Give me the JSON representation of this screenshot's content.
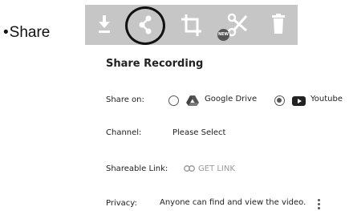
{
  "bullet": {
    "marker": "•",
    "label": "Share"
  },
  "toolbar": {
    "buttons": [
      {
        "name": "download-icon"
      },
      {
        "name": "share-icon",
        "highlighted": true
      },
      {
        "name": "crop-icon"
      },
      {
        "name": "scissors-icon",
        "badge": "NEW"
      },
      {
        "name": "trash-icon"
      }
    ],
    "background_color": "#c6c6c6",
    "icon_color": "#ffffff"
  },
  "panel": {
    "title": "Share Recording",
    "share_on": {
      "label": "Share on:",
      "options": [
        {
          "label": "Google Drive",
          "icon": "google-drive-icon",
          "selected": false
        },
        {
          "label": "Youtube",
          "icon": "youtube-icon",
          "selected": true
        }
      ]
    },
    "channel": {
      "label": "Channel:",
      "value": "Please Select"
    },
    "shareable_link": {
      "label": "Shareable Link:",
      "button_label": "GET LINK",
      "icon": "link-icon"
    },
    "privacy": {
      "label": "Privacy:",
      "value": "Anyone can find and view the video.",
      "menu_icon": "more-vertical-icon"
    }
  }
}
